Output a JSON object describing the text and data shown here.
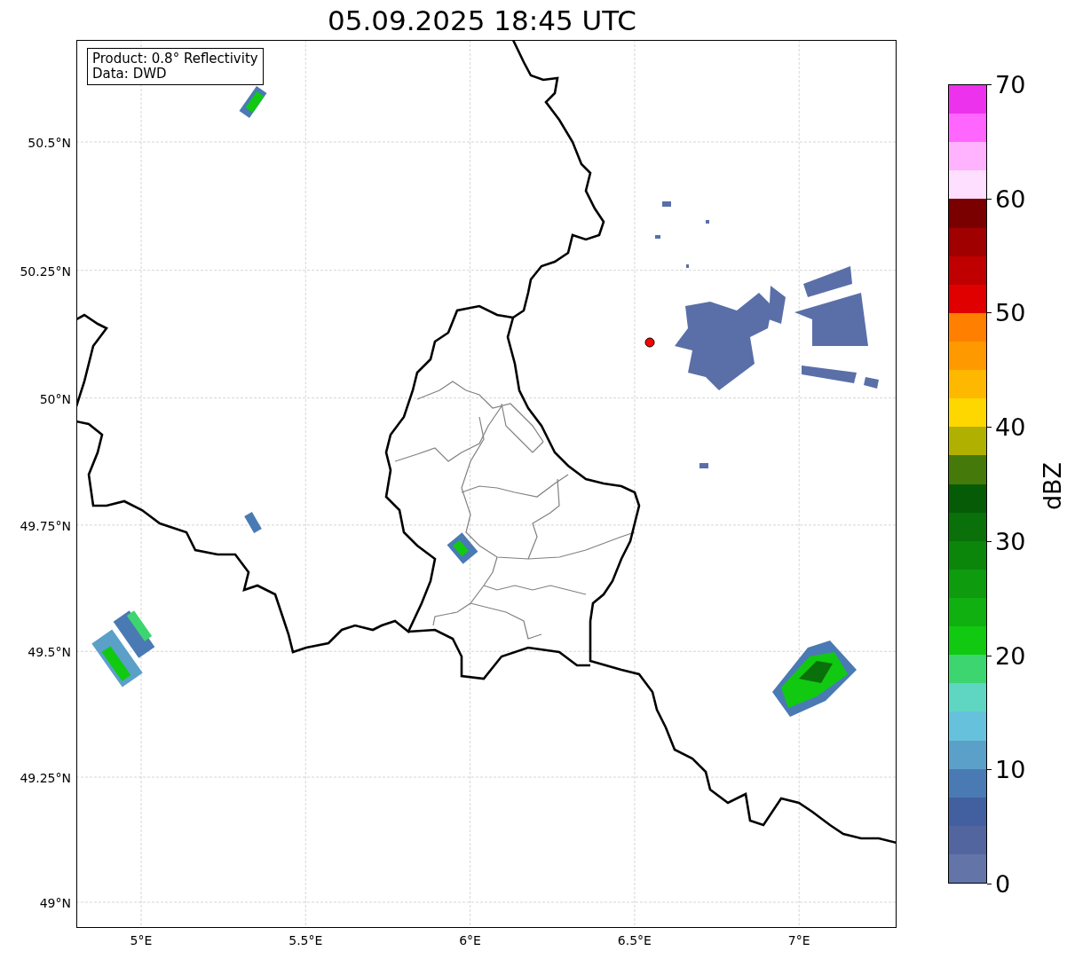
{
  "title": "05.09.2025 18:45 UTC",
  "annotation": [
    "Product: 0.8° Reflectivity",
    "Data: DWD"
  ],
  "map": {
    "lat_ticks": [
      "50.5°N",
      "50.25°N",
      "50°N",
      "49.75°N",
      "49.5°N",
      "49.25°N",
      "49°N"
    ],
    "lon_ticks": [
      "5°E",
      "5.5°E",
      "6°E",
      "6.5°E",
      "7°E"
    ]
  },
  "colorbar": {
    "label": "dBZ",
    "ticks": [
      "70",
      "60",
      "50",
      "40",
      "30",
      "20",
      "10",
      "0"
    ],
    "bins": [
      {
        "color": "#ec32ec"
      },
      {
        "color": "#ff66ff"
      },
      {
        "color": "#ffb3ff"
      },
      {
        "color": "#ffdfff"
      },
      {
        "color": "#7a0000"
      },
      {
        "color": "#a00000"
      },
      {
        "color": "#c00000"
      },
      {
        "color": "#e00000"
      },
      {
        "color": "#ff7f00"
      },
      {
        "color": "#ff9900"
      },
      {
        "color": "#ffb800"
      },
      {
        "color": "#ffd700"
      },
      {
        "color": "#b0b000"
      },
      {
        "color": "#457a0a"
      },
      {
        "color": "#065c06"
      },
      {
        "color": "#0a700a"
      },
      {
        "color": "#0b860b"
      },
      {
        "color": "#0e9b0e"
      },
      {
        "color": "#10b010"
      },
      {
        "color": "#11c911"
      },
      {
        "color": "#3dd56f"
      },
      {
        "color": "#5fd6c2"
      },
      {
        "color": "#66c2dc"
      },
      {
        "color": "#5aa0c8"
      },
      {
        "color": "#4a7ab4"
      },
      {
        "color": "#4260a0"
      },
      {
        "color": "#52659f"
      },
      {
        "color": "#6374a8"
      }
    ]
  }
}
